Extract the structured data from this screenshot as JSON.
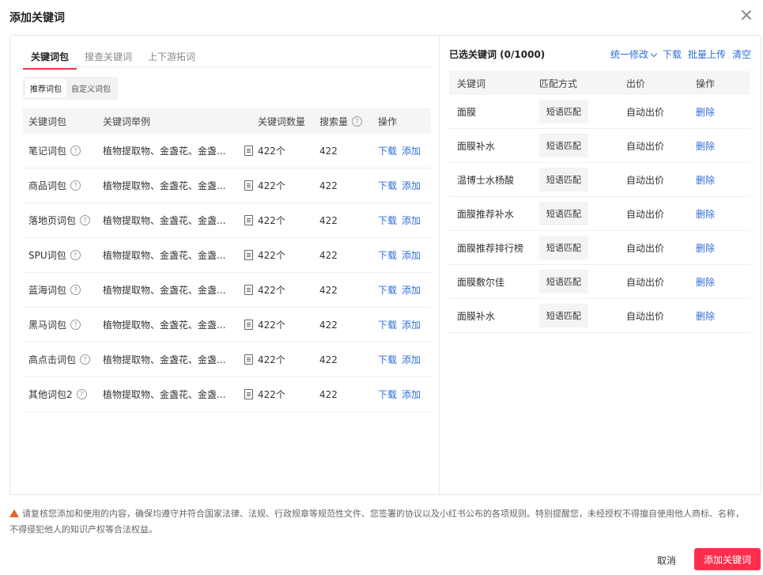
{
  "dialog": {
    "title": "添加关键词"
  },
  "left": {
    "tabs": [
      "关键词包",
      "搜查关键词",
      "上下游拓词"
    ],
    "segments": [
      "推荐词包",
      "自定义词包"
    ],
    "headers": {
      "package": "关键词包",
      "examples": "关键词举例",
      "count": "关键词数量",
      "volume": "搜索量",
      "action": "操作"
    },
    "rows": [
      {
        "name": "笔记词包",
        "examples": "植物提取物、金盏花、金盏...",
        "count": "422个",
        "volume": "422"
      },
      {
        "name": "商品词包",
        "examples": "植物提取物、金盏花、金盏...",
        "count": "422个",
        "volume": "422"
      },
      {
        "name": "落地页词包",
        "examples": "植物提取物、金盏花、金盏...",
        "count": "422个",
        "volume": "422"
      },
      {
        "name": "SPU词包",
        "examples": "植物提取物、金盏花、金盏...",
        "count": "422个",
        "volume": "422"
      },
      {
        "name": "蓝海词包",
        "examples": "植物提取物、金盏花、金盏...",
        "count": "422个",
        "volume": "422"
      },
      {
        "name": "黑马词包",
        "examples": "植物提取物、金盏花、金盏...",
        "count": "422个",
        "volume": "422"
      },
      {
        "name": "高点击词包",
        "examples": "植物提取物、金盏花、金盏...",
        "count": "422个",
        "volume": "422"
      },
      {
        "name": "其他词包2",
        "examples": "植物提取物、金盏花、金盏...",
        "count": "422个",
        "volume": "422"
      }
    ],
    "download_label": "下载",
    "add_label": "添加"
  },
  "right": {
    "title": "已选关键词 (0/1000)",
    "actions": {
      "bulk_edit": "统一修改",
      "download": "下载",
      "bulk_upload": "批量上传",
      "clear": "清空"
    },
    "headers": {
      "keyword": "关键词",
      "match": "匹配方式",
      "bid": "出价",
      "action": "操作"
    },
    "rows": [
      {
        "keyword": "面膜",
        "match": "短语匹配",
        "bid": "自动出价"
      },
      {
        "keyword": "面膜补水",
        "match": "短语匹配",
        "bid": "自动出价"
      },
      {
        "keyword": "温博士水杨酸",
        "match": "短语匹配",
        "bid": "自动出价"
      },
      {
        "keyword": "面膜推荐补水",
        "match": "短语匹配",
        "bid": "自动出价"
      },
      {
        "keyword": "面膜推荐排行榜",
        "match": "短语匹配",
        "bid": "自动出价"
      },
      {
        "keyword": "面膜敷尔佳",
        "match": "短语匹配",
        "bid": "自动出价"
      },
      {
        "keyword": "面膜补水",
        "match": "短语匹配",
        "bid": "自动出价"
      }
    ],
    "delete_label": "删除"
  },
  "notice": "请复核您添加和使用的内容，确保均遵守并符合国家法律、法规、行政规章等规范性文件、您签署的协议以及小红书公布的各项规则。特别提醒您，未经授权不得擅自使用他人商标、名称，不得侵犯他人的知识产权等合法权益。",
  "footer": {
    "cancel": "取消",
    "confirm": "添加关键词"
  },
  "colors": {
    "accent": "#ff2e4d",
    "link": "#2f6fd6",
    "warning": "#e8632a"
  }
}
